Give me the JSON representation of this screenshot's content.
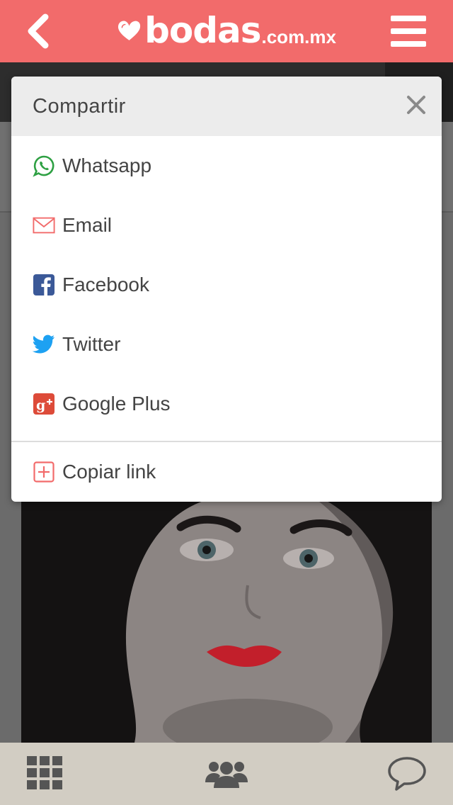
{
  "header": {
    "back_icon": "chevron-left-icon",
    "logo": {
      "brand": "bodas",
      "tld": ".com.mx"
    },
    "menu_icon": "hamburger-menu-icon"
  },
  "share_modal": {
    "title": "Compartir",
    "close_icon": "close-icon",
    "options": [
      {
        "label": "Whatsapp",
        "icon": "whatsapp-icon",
        "color": "#2ea043"
      },
      {
        "label": "Email",
        "icon": "email-icon",
        "color": "#f26b6b"
      },
      {
        "label": "Facebook",
        "icon": "facebook-icon",
        "color": "#3b5998"
      },
      {
        "label": "Twitter",
        "icon": "twitter-icon",
        "color": "#1da1f2"
      },
      {
        "label": "Google Plus",
        "icon": "google-plus-icon",
        "color": "#dd4b39"
      }
    ],
    "copy_link": {
      "label": "Copiar link",
      "icon": "plus-square-icon",
      "color": "#f26b6b"
    }
  },
  "bottom_nav": [
    {
      "icon": "grid-icon"
    },
    {
      "icon": "users-icon"
    },
    {
      "icon": "chat-bubble-icon"
    }
  ],
  "colors": {
    "brand": "#f26b6b",
    "bottom_bar": "#d2cdc3",
    "overlay": "#6b6b6b"
  }
}
